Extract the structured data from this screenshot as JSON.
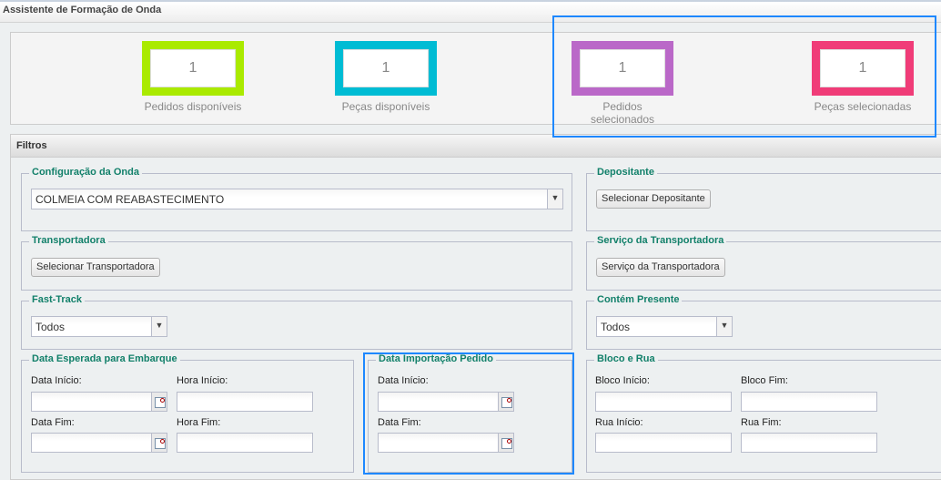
{
  "window": {
    "title": "Assistente de Formação de Onda"
  },
  "counters": [
    {
      "value": "1",
      "label": "Pedidos disponíveis",
      "color": "#aaea00"
    },
    {
      "value": "1",
      "label": "Peças disponíveis",
      "color": "#00bcd4"
    },
    {
      "value": "1",
      "label": "Pedidos selecionados",
      "color": "#ba68c8"
    },
    {
      "value": "1",
      "label": "Peças selecionadas",
      "color": "#f03c78"
    }
  ],
  "filters": {
    "title": "Filtros",
    "config_onda": {
      "legend": "Configuração da Onda",
      "selected": "COLMEIA COM REABASTECIMENTO"
    },
    "depositante": {
      "legend": "Depositante",
      "button": "Selecionar Depositante"
    },
    "transportadora": {
      "legend": "Transportadora",
      "button": "Selecionar Transportadora"
    },
    "servico": {
      "legend": "Serviço da Transportadora",
      "button": "Serviço da Transportadora"
    },
    "fast_track": {
      "legend": "Fast-Track",
      "selected": "Todos"
    },
    "contem_presente": {
      "legend": "Contém Presente",
      "selected": "Todos"
    },
    "data_embarque": {
      "legend": "Data Esperada para Embarque",
      "data_inicio": "Data Início:",
      "hora_inicio": "Hora Início:",
      "data_fim": "Data Fim:",
      "hora_fim": "Hora Fim:"
    },
    "data_importacao": {
      "legend": "Data Importação Pedido",
      "data_inicio": "Data Início:",
      "data_fim": "Data Fim:"
    },
    "bloco_rua": {
      "legend": "Bloco e Rua",
      "bloco_inicio": "Bloco Início:",
      "bloco_fim": "Bloco Fim:",
      "rua_inicio": "Rua Início:",
      "rua_fim": "Rua Fim:"
    }
  },
  "highlight_color": "#1e88ff",
  "icons": {
    "dropdown": "chevron-down-icon",
    "calendar": "calendar-icon"
  }
}
